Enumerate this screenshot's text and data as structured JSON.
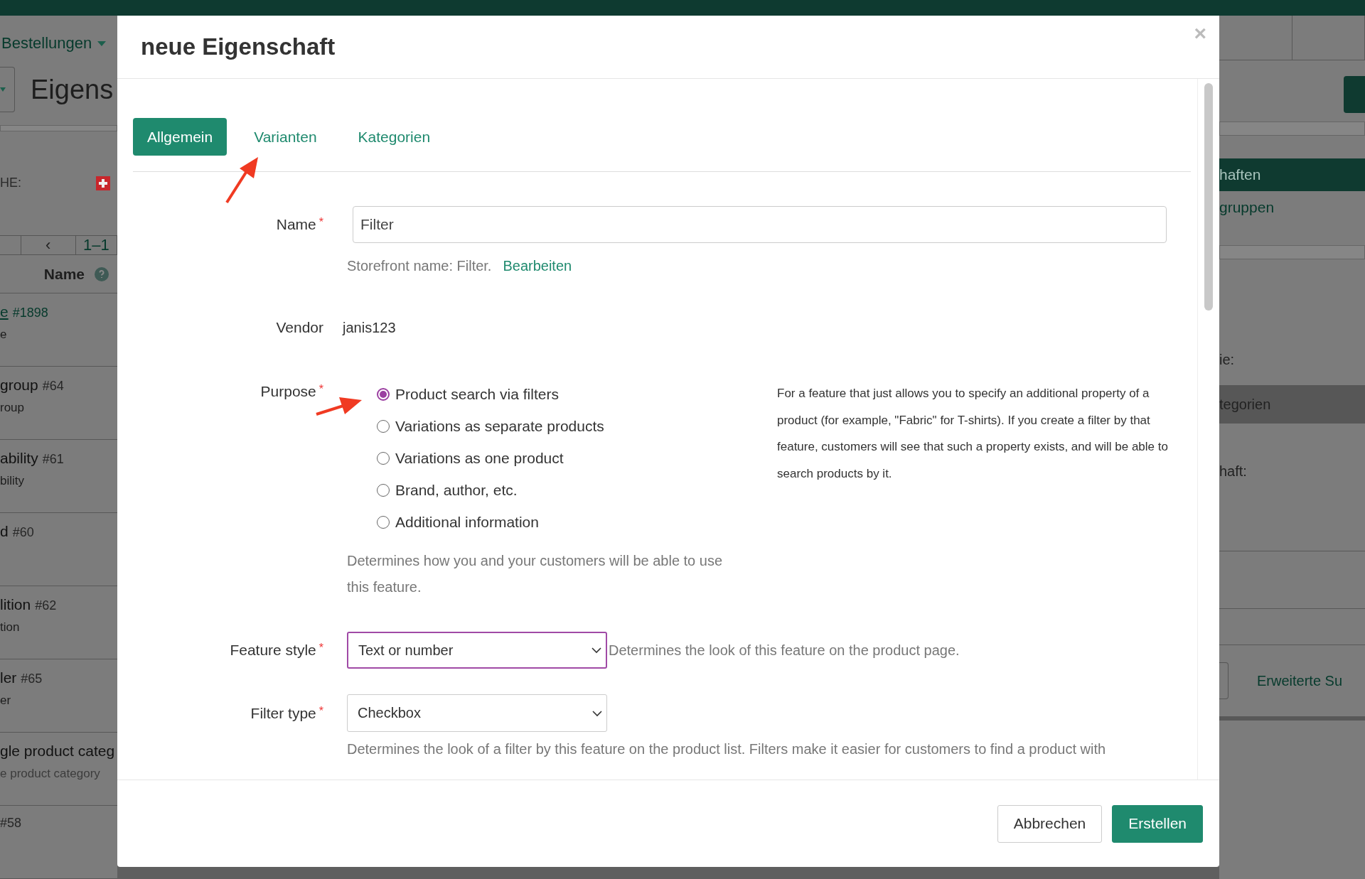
{
  "background": {
    "nav_item": "Bestellungen",
    "page_title": "Eigens",
    "filter_label": "HE:",
    "pagination": {
      "prev": "‹",
      "range": "1–1"
    },
    "column_header": "Name",
    "rows": [
      {
        "title": "e",
        "link": true,
        "id": "#1898",
        "sub": "e"
      },
      {
        "title": "group",
        "link": false,
        "id": "#64",
        "sub": "roup"
      },
      {
        "title": "ability",
        "link": false,
        "id": "#61",
        "sub": "bility"
      },
      {
        "title": "d",
        "link": false,
        "id": "#60"
      },
      {
        "title": "lition",
        "link": false,
        "id": "#62",
        "sub": "tion"
      },
      {
        "title": "ler",
        "link": false,
        "id": "#65",
        "sub": "er"
      },
      {
        "title": "gle product categ",
        "link": false,
        "sub": "e product category"
      },
      {
        "id": "#58",
        "link": false
      }
    ],
    "side_menu": [
      {
        "label": "haften",
        "selected": true
      },
      {
        "label": "gruppen",
        "selected": false
      }
    ],
    "side_labels": [
      "ie:",
      "tegorien",
      "haft:"
    ],
    "advanced_search": "Erweiterte Su"
  },
  "dialog": {
    "title": "neue Eigenschaft",
    "close": "×",
    "required_mark": "*",
    "tabs": [
      {
        "label": "Allgemein",
        "selected": true
      },
      {
        "label": "Varianten",
        "selected": false
      },
      {
        "label": "Kategorien",
        "selected": false
      }
    ],
    "name": {
      "label": "Name",
      "required": true,
      "value": "Filter"
    },
    "storefront": {
      "text": "Storefront name: Filter.",
      "link": "Bearbeiten"
    },
    "vendor": {
      "label": "Vendor",
      "value": "janis123"
    },
    "purpose": {
      "label": "Purpose",
      "required": true,
      "options": [
        {
          "label": "Product search via filters",
          "selected": true
        },
        {
          "label": "Variations as separate products",
          "selected": false
        },
        {
          "label": "Variations as one product",
          "selected": false
        },
        {
          "label": "Brand, author, etc.",
          "selected": false
        },
        {
          "label": "Additional information",
          "selected": false
        }
      ],
      "help": "For a feature that just allows you to specify an additional property of a product (for example, \"Fabric\" for T-shirts). If you create a filter by that feature, customers will see that such a property exists, and will be able to search products by it.",
      "hint": "Determines how you and your customers will be able to use this feature."
    },
    "feature_style": {
      "label": "Feature style",
      "required": true,
      "value": "Text or number",
      "focused": true,
      "hint": "Determines the look of this feature on the product page."
    },
    "filter_type": {
      "label": "Filter type",
      "required": true,
      "value": "Checkbox",
      "focused": false,
      "hint": "Determines the look of a filter by this feature on the product list. Filters make it easier for customers to find a product with"
    },
    "buttons": {
      "cancel": "Abbrechen",
      "create": "Erstellen"
    }
  }
}
